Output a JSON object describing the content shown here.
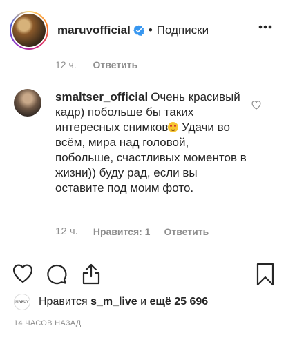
{
  "header": {
    "username": "maruvofficial",
    "separator": "•",
    "follow_label": "Подписки",
    "verified_icon": "verified-badge-icon",
    "more_icon": "more-horizontal-icon",
    "verified_color": "#3897f0"
  },
  "previous_comment": {
    "time": "12 ч.",
    "reply_label": "Ответить"
  },
  "comment": {
    "username": "smaltser_official",
    "text_part1": "Очень красивый кадр) побольше бы таких интересных снимков",
    "emoji": "smiling-face-emoji",
    "text_part2": "Удачи во всём, мира над головой, побольше, счастливых моментов в жизни)) буду рад, если вы оставите под моим фото.",
    "time": "12 ч.",
    "likes_label": "Нравится: 1",
    "reply_label": "Ответить",
    "like_icon": "heart-outline-icon"
  },
  "actions": {
    "like_icon": "heart-outline-icon",
    "comment_icon": "comment-bubble-icon",
    "share_icon": "share-upload-icon",
    "save_icon": "bookmark-icon"
  },
  "likes": {
    "prefix": "Нравится",
    "user": "s_m_live",
    "middle": "и",
    "others": "ещё 25 696",
    "liker_avatar_text": "MARUV"
  },
  "post_time": "14 часов назад"
}
